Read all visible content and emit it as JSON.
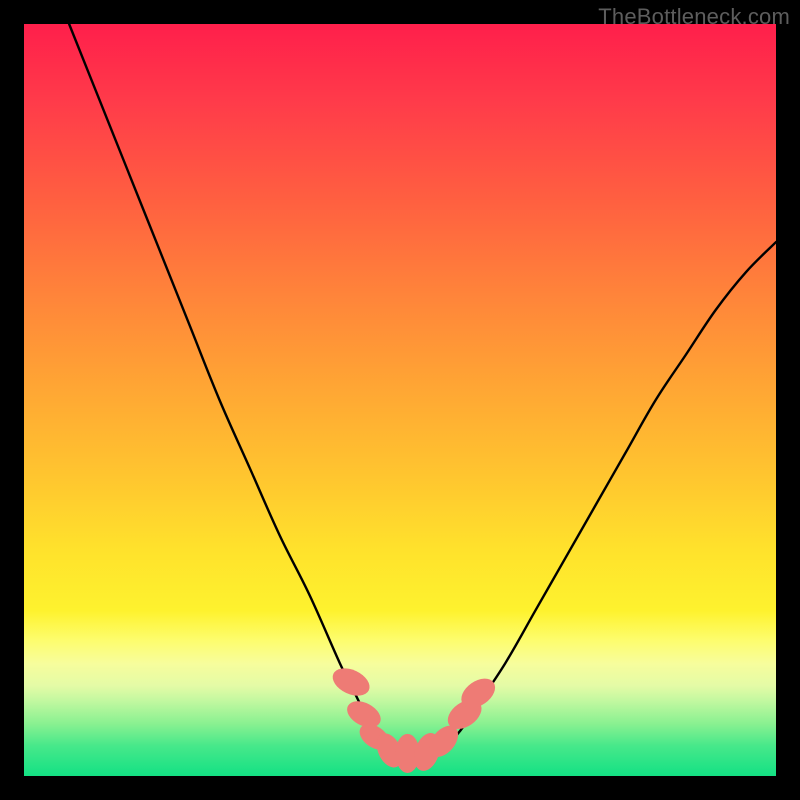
{
  "watermark": "TheBottleneck.com",
  "chart_data": {
    "type": "line",
    "title": "",
    "xlabel": "",
    "ylabel": "",
    "xlim": [
      0,
      100
    ],
    "ylim": [
      0,
      100
    ],
    "series": [
      {
        "name": "curve",
        "x": [
          6,
          10,
          14,
          18,
          22,
          26,
          30,
          34,
          38,
          42,
          44,
          46,
          48,
          50,
          52,
          54,
          56,
          58,
          60,
          64,
          68,
          72,
          76,
          80,
          84,
          88,
          92,
          96,
          100
        ],
        "values": [
          100,
          90,
          80,
          70,
          60,
          50,
          41,
          32,
          24,
          15,
          11,
          7,
          4,
          3,
          3,
          3,
          4,
          6,
          9,
          15,
          22,
          29,
          36,
          43,
          50,
          56,
          62,
          67,
          71
        ]
      }
    ],
    "markers": {
      "name": "trough-beads",
      "color": "#ee7b75",
      "points": [
        {
          "x": 43.5,
          "y": 12.5,
          "rx": 1.6,
          "ry": 2.6,
          "rot": -65
        },
        {
          "x": 45.2,
          "y": 8.2,
          "rx": 1.5,
          "ry": 2.4,
          "rot": -62
        },
        {
          "x": 46.6,
          "y": 5.2,
          "rx": 1.4,
          "ry": 2.2,
          "rot": -55
        },
        {
          "x": 48.6,
          "y": 3.4,
          "rx": 1.5,
          "ry": 2.4,
          "rot": -25
        },
        {
          "x": 51.0,
          "y": 3.0,
          "rx": 1.6,
          "ry": 2.6,
          "rot": 0
        },
        {
          "x": 53.6,
          "y": 3.2,
          "rx": 1.6,
          "ry": 2.6,
          "rot": 18
        },
        {
          "x": 55.8,
          "y": 4.6,
          "rx": 1.5,
          "ry": 2.4,
          "rot": 40
        },
        {
          "x": 58.6,
          "y": 8.2,
          "rx": 1.6,
          "ry": 2.5,
          "rot": 55
        },
        {
          "x": 60.4,
          "y": 11.0,
          "rx": 1.6,
          "ry": 2.5,
          "rot": 55
        }
      ]
    }
  }
}
